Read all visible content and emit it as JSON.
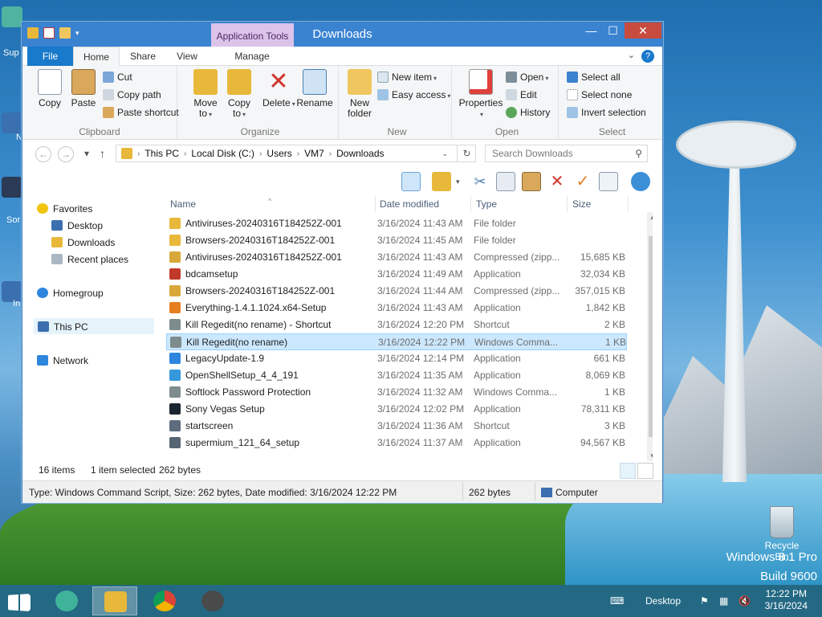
{
  "desktop": {
    "watermark_line1": "Windows 8.1 Pro",
    "watermark_line2": "Build 9600",
    "recycle_bin_label": "Recycle Bin",
    "left_icon_labels": [
      "Sup",
      "N",
      "Sor",
      "In"
    ]
  },
  "window": {
    "title": "Downloads",
    "context_tab": "Application Tools",
    "buttons": {
      "minimize": "—",
      "maximize": "☐",
      "close": "✕"
    },
    "help": "?",
    "tabs": {
      "file": "File",
      "home": "Home",
      "share": "Share",
      "view": "View",
      "manage": "Manage"
    }
  },
  "ribbon": {
    "clipboard": {
      "label": "Clipboard",
      "copy": "Copy",
      "paste": "Paste",
      "cut": "Cut",
      "copy_path": "Copy path",
      "paste_shortcut": "Paste shortcut"
    },
    "organize": {
      "label": "Organize",
      "move_to_1": "Move",
      "move_to_2": "to",
      "copy_to_1": "Copy",
      "copy_to_2": "to",
      "delete": "Delete",
      "rename": "Rename"
    },
    "new": {
      "label": "New",
      "new_folder_1": "New",
      "new_folder_2": "folder",
      "new_item": "New item",
      "easy_access": "Easy access"
    },
    "open": {
      "label": "Open",
      "properties": "Properties",
      "open": "Open",
      "edit": "Edit",
      "history": "History"
    },
    "select": {
      "label": "Select",
      "select_all": "Select all",
      "select_none": "Select none",
      "invert": "Invert selection"
    }
  },
  "address": {
    "crumbs": [
      "This PC",
      "Local Disk (C:)",
      "Users",
      "VM7",
      "Downloads"
    ],
    "search_placeholder": "Search Downloads"
  },
  "nav": {
    "favorites": "Favorites",
    "desktop": "Desktop",
    "downloads": "Downloads",
    "recent": "Recent places",
    "homegroup": "Homegroup",
    "thispc": "This PC",
    "network": "Network"
  },
  "columns": {
    "name": "Name",
    "date": "Date modified",
    "type": "Type",
    "size": "Size"
  },
  "files": [
    {
      "name": "Antiviruses-20240316T184252Z-001",
      "date": "3/16/2024 11:43 AM",
      "type": "File folder",
      "size": "",
      "color": "#e8b83b"
    },
    {
      "name": "Browsers-20240316T184252Z-001",
      "date": "3/16/2024 11:45 AM",
      "type": "File folder",
      "size": "",
      "color": "#e8b83b"
    },
    {
      "name": "Antiviruses-20240316T184252Z-001",
      "date": "3/16/2024 11:43 AM",
      "type": "Compressed (zipp...",
      "size": "15,685 KB",
      "color": "#d9a83a"
    },
    {
      "name": "bdcamsetup",
      "date": "3/16/2024 11:49 AM",
      "type": "Application",
      "size": "32,034 KB",
      "color": "#c0392b"
    },
    {
      "name": "Browsers-20240316T184252Z-001",
      "date": "3/16/2024 11:44 AM",
      "type": "Compressed (zipp...",
      "size": "357,015 KB",
      "color": "#d9a83a"
    },
    {
      "name": "Everything-1.4.1.1024.x64-Setup",
      "date": "3/16/2024 11:43 AM",
      "type": "Application",
      "size": "1,842 KB",
      "color": "#e67e22"
    },
    {
      "name": "Kill Regedit(no rename) - Shortcut",
      "date": "3/16/2024 12:20 PM",
      "type": "Shortcut",
      "size": "2 KB",
      "color": "#7f8c8d"
    },
    {
      "name": "Kill Regedit(no rename)",
      "date": "3/16/2024 12:22 PM",
      "type": "Windows Comma...",
      "size": "1 KB",
      "color": "#7f8c8d"
    },
    {
      "name": "LegacyUpdate-1.9",
      "date": "3/16/2024 12:14 PM",
      "type": "Application",
      "size": "661 KB",
      "color": "#2e86de"
    },
    {
      "name": "OpenShellSetup_4_4_191",
      "date": "3/16/2024 11:35 AM",
      "type": "Application",
      "size": "8,069 KB",
      "color": "#3498db"
    },
    {
      "name": "Softlock Password Protection",
      "date": "3/16/2024 11:32 AM",
      "type": "Windows Comma...",
      "size": "1 KB",
      "color": "#7f8c8d"
    },
    {
      "name": "Sony Vegas Setup",
      "date": "3/16/2024 12:02 PM",
      "type": "Application",
      "size": "78,311 KB",
      "color": "#1b2631"
    },
    {
      "name": "startscreen",
      "date": "3/16/2024 11:36 AM",
      "type": "Shortcut",
      "size": "3 KB",
      "color": "#5d6d7e"
    },
    {
      "name": "supermium_121_64_setup",
      "date": "3/16/2024 11:37 AM",
      "type": "Application",
      "size": "94,567 KB",
      "color": "#566573"
    }
  ],
  "selected_index": 7,
  "info": {
    "count": "16 items",
    "selected": "1 item selected",
    "bytes": "262 bytes"
  },
  "status": {
    "details": "Type: Windows Command Script, Size: 262 bytes, Date modified: 3/16/2024 12:22 PM",
    "size": "262 bytes",
    "location": "Computer"
  },
  "taskbar": {
    "desktop_label": "Desktop",
    "time": "12:22 PM",
    "date": "3/16/2024"
  }
}
